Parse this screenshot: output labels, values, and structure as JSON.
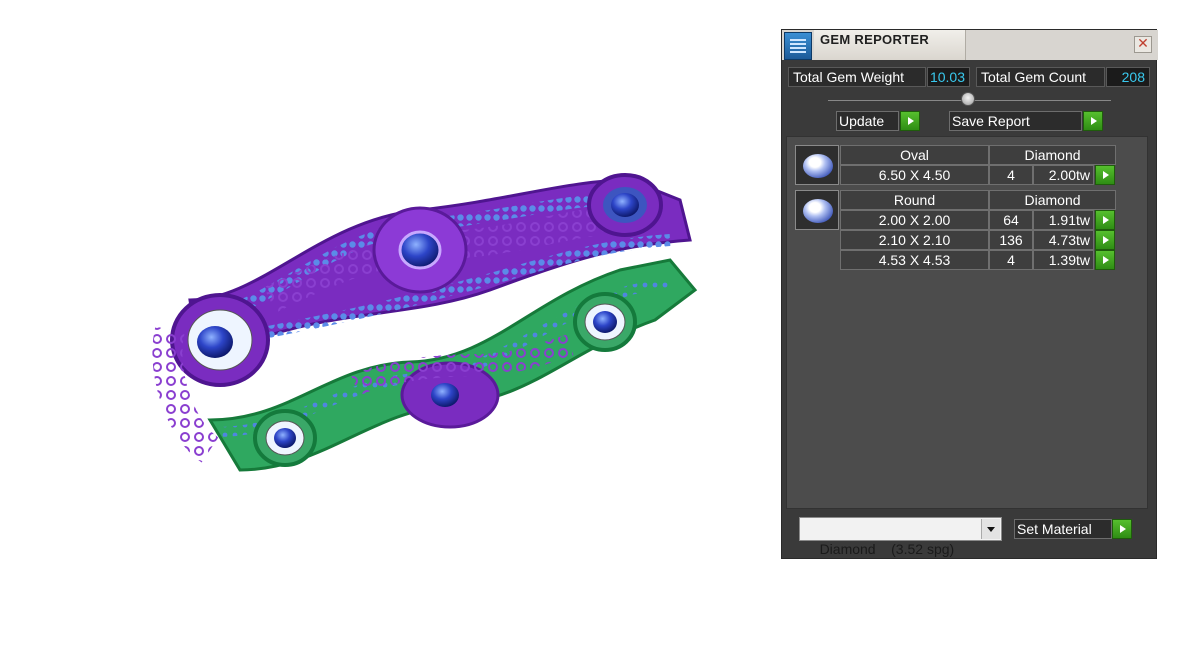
{
  "panel": {
    "title": "GEM REPORTER",
    "close_glyph": "✕",
    "total_weight_label": "Total Gem Weight",
    "total_weight_value": "10.03",
    "total_count_label": "Total Gem Count",
    "total_count_value": "208",
    "update_label": "Update",
    "save_report_label": "Save Report",
    "groups": [
      {
        "icon": "oval-gem-icon",
        "shape": "Oval",
        "material": "Diamond",
        "rows": [
          {
            "size": "6.50 X 4.50",
            "count": "4",
            "weight": "2.00tw"
          }
        ]
      },
      {
        "icon": "round-gem-icon",
        "shape": "Round",
        "material": "Diamond",
        "rows": [
          {
            "size": "2.00 X 2.00",
            "count": "64",
            "weight": "1.91tw"
          },
          {
            "size": "2.10 X 2.10",
            "count": "136",
            "weight": "4.73tw"
          },
          {
            "size": "4.53 X 4.53",
            "count": "4",
            "weight": "1.39tw"
          }
        ]
      }
    ],
    "material_select_value": "Diamond    (3.52 spg)",
    "set_material_label": "Set Material"
  },
  "colors": {
    "value_text": "#39c9ee",
    "go_button": "#4fb02a",
    "panel_bg": "#3a3a3a",
    "ring_metal_top": "#7a2cc0",
    "ring_metal_bottom": "#2aa85a",
    "ring_stones": "#4a78d8"
  }
}
